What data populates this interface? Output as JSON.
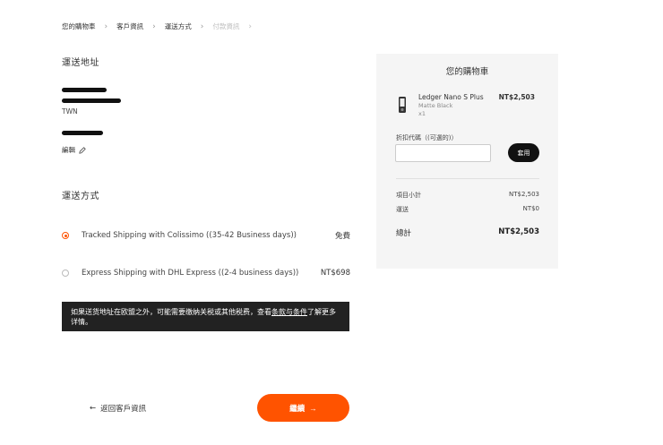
{
  "breadcrumb": {
    "items": [
      "您的購物車",
      "客戶資訊",
      "運送方式",
      "付款資訊"
    ]
  },
  "address": {
    "heading": "運送地址",
    "country": "TWN",
    "edit_label": "編輯"
  },
  "shipping": {
    "heading": "運送方式",
    "options": [
      {
        "label": "Tracked Shipping with Colissimo ((35-42 Business days))",
        "price": "免費",
        "selected": true
      },
      {
        "label": "Express Shipping with DHL Express ((2-4 business days))",
        "price": "NT$698",
        "selected": false
      }
    ]
  },
  "notice": {
    "text_before": "如果送货地址在欧盟之外，可能需要缴纳关税或其他税费，查看",
    "link_text": "条款与条件",
    "text_after": "了解更多详情。"
  },
  "actions": {
    "back_label": "返回客戶資訊",
    "continue_label": "繼續"
  },
  "cart": {
    "title": "您的購物車",
    "product": {
      "name": "Ledger Nano S Plus",
      "variant": "Matte Black",
      "qty": "x1",
      "price": "NT$2,503"
    },
    "discount_label": "折扣代碼（(可選的)）",
    "discount_placeholder": "",
    "apply_label": "套用",
    "subtotal_label": "項目小計",
    "subtotal_value": "NT$2,503",
    "shipping_label": "運送",
    "shipping_value": "NT$0",
    "total_label": "總計",
    "total_value": "NT$2,503"
  },
  "colors": {
    "accent": "#ff5300",
    "notice_bg": "#222222",
    "cart_bg": "#f5f5f5"
  }
}
